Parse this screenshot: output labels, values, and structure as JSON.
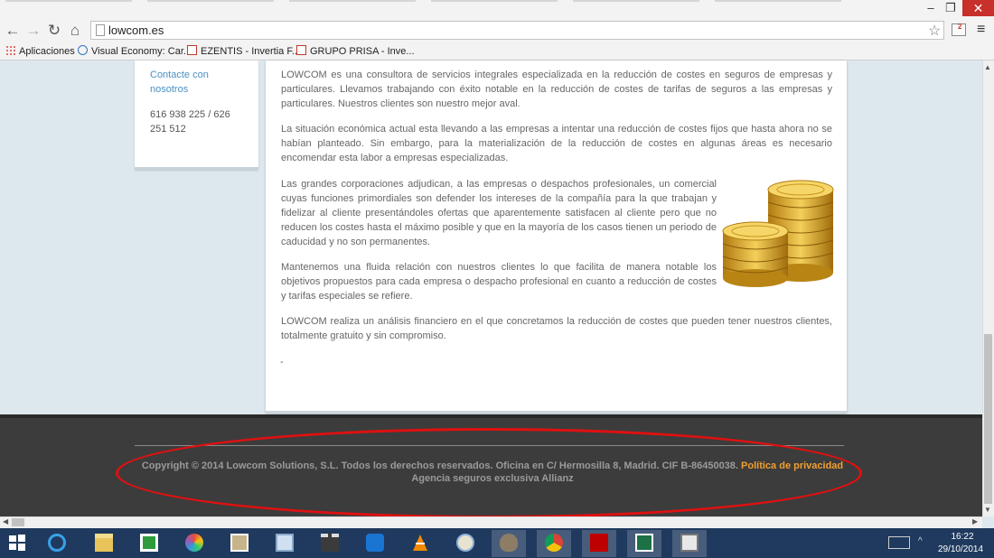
{
  "browser": {
    "url": "lowcom.es",
    "window_buttons": {
      "minimize": "–",
      "restore": "❐",
      "close": "✕"
    },
    "nav_icons": {
      "back": "←",
      "forward": "→",
      "reload": "↻",
      "home": "⌂"
    },
    "star_icon": "☆",
    "menu_icon": "≡",
    "extension_badge": "2",
    "bookmarks": [
      {
        "label": "Aplicaciones",
        "icon": "apps-icon"
      },
      {
        "label": "Visual Economy: Car...",
        "icon": "visual-economy-icon"
      },
      {
        "label": "EZENTIS - Invertia F...",
        "icon": "prisa-icon"
      },
      {
        "label": "GRUPO PRISA - Inve...",
        "icon": "prisa-icon"
      }
    ]
  },
  "sidebar": {
    "contact_link": "Contacte con nosotros",
    "phone": "616 938 225 / 626 251 512"
  },
  "content": {
    "paragraphs": [
      "LOWCOM es una consultora de servicios integrales  especializada en la reducción de costes en seguros de empresas y particulares. Llevamos trabajando con éxito notable en la reducción de costes de tarifas de seguros a las empresas y particulares. Nuestros clientes son nuestro mejor aval.",
      "La situación económica actual esta llevando a las empresas a intentar una reducción de costes fijos que hasta ahora no se habían planteado. Sin embargo, para la materialización de la reducción de costes en algunas áreas es necesario encomendar esta labor a empresas especializadas.",
      "Las grandes corporaciones adjudican, a las empresas o despachos profesionales, un comercial cuyas funciones primordiales son defender los intereses de la compañía para la que trabajan y fidelizar al cliente presentándoles ofertas que aparentemente satisfacen al cliente pero que no reducen los costes hasta el máximo posible y que en la mayoría de los casos tienen un periodo de caducidad y no son permanentes.",
      "Mantenemos una fluida relación con nuestros clientes lo que facilita de manera notable los objetivos propuestos para cada empresa o despacho profesional en cuanto a reducción de costes y tarifas  especiales se refiere.",
      "LOWCOM realiza un análisis financiero en el que concretamos la reducción de costes que pueden tener nuestros clientes, totalmente gratuito y sin compromiso."
    ],
    "trailing_mark": "-"
  },
  "footer": {
    "copyright": "Copyright © 2014 Lowcom Solutions, S.L. Todos los derechos reservados. Oficina en C/ Hermosilla 8, Madrid. CIF B-86450038.",
    "privacy_link": "Política de privacidad",
    "agency": "Agencia seguros exclusiva Allianz",
    "annotation_color": "#e01010"
  },
  "scrollbars": {
    "up": "▲",
    "down": "▼",
    "left": "◀",
    "right": "▶"
  },
  "taskbar": {
    "icons": [
      "windows-start-icon",
      "internet-explorer-icon",
      "file-explorer-icon",
      "store-icon",
      "picasa-icon",
      "photo-viewer-icon",
      "calculator-icon",
      "movie-maker-icon",
      "teamviewer-icon",
      "vlc-icon",
      "paint-icon",
      "gimp-icon",
      "chrome-icon",
      "filezilla-icon",
      "excel-icon",
      "clipboard-icon"
    ],
    "time": "16:22",
    "date": "29/10/2014",
    "tray_chevron": "^"
  }
}
